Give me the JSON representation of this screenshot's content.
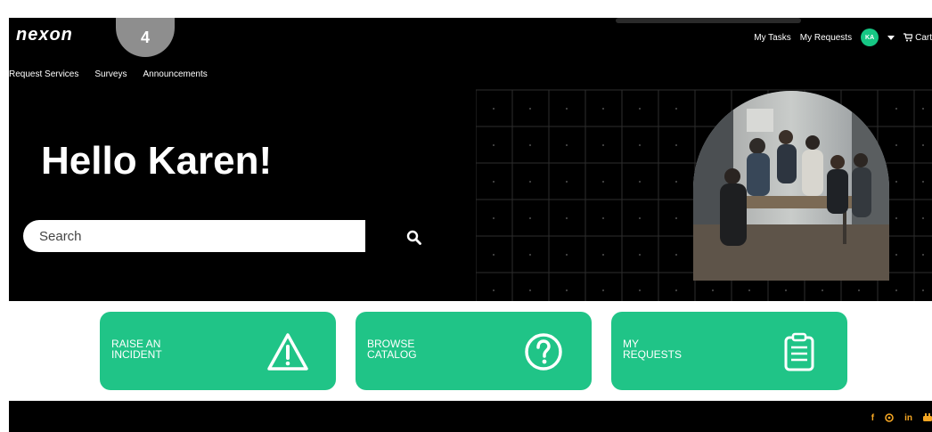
{
  "header": {
    "logo_text": "nexon",
    "step_badge": "4",
    "nav": [
      "Request Services",
      "Surveys",
      "Announcements"
    ],
    "right_links": [
      "My Tasks",
      "My Requests"
    ],
    "avatar_initials": "KA",
    "cart_label": "Cart"
  },
  "hero": {
    "greeting": "Hello Karen!",
    "search_placeholder": "Search"
  },
  "tiles": [
    {
      "label": "RAISE AN\nINCIDENT",
      "icon": "warning-icon"
    },
    {
      "label": "BROWSE\nCATALOG",
      "icon": "question-icon"
    },
    {
      "label": "MY\nREQUESTS",
      "icon": "clipboard-list-icon"
    }
  ],
  "footer": {
    "social_labels": [
      "f",
      "in"
    ],
    "social_icons": [
      "facebook-icon",
      "globe-icon",
      "linkedin-icon",
      "youtube-icon"
    ]
  },
  "colors": {
    "accent": "#20c487",
    "background": "#000000",
    "social": "#f5a623"
  }
}
